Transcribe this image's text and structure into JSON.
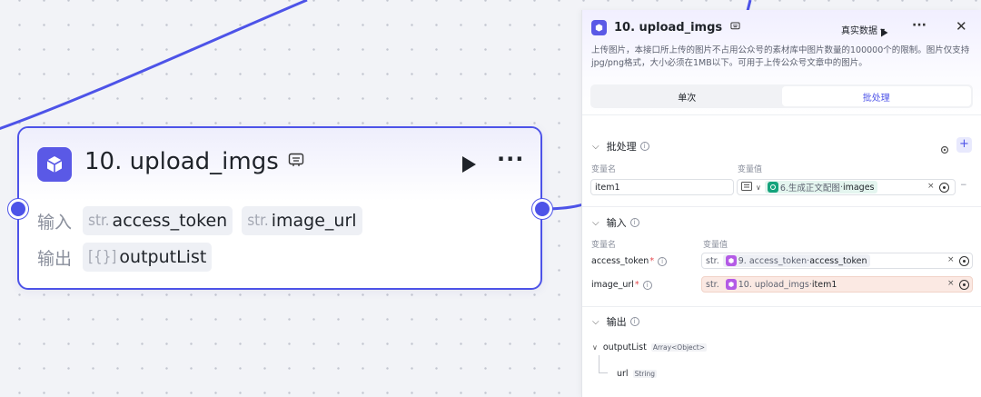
{
  "node": {
    "title": "10. upload_imgs",
    "input_label": "输入",
    "output_label": "输出",
    "inputs": [
      {
        "type": "str.",
        "name": "access_token"
      },
      {
        "type": "str.",
        "name": "image_url"
      }
    ],
    "outputs": [
      {
        "type": "[{}]",
        "name": "outputList"
      }
    ],
    "more": "···"
  },
  "panel": {
    "title": "10. upload_imgs",
    "mode": "真实数据 ▾",
    "more": "···",
    "close": "✕",
    "description": "上传图片，本接口所上传的图片不占用公众号的素材库中图片数量的100000个的限制。图片仅支持jpg/png格式，大小必须在1MB以下。可用于上传公众号文章中的图片。",
    "tabs": [
      {
        "label": "单次",
        "active": false
      },
      {
        "label": "批处理",
        "active": true
      }
    ],
    "batch": {
      "title": "批处理",
      "col_name": "变量名",
      "col_value": "变量值",
      "item_name": "item1",
      "ref_node": "6.生成正文配图",
      "ref_sep": " · ",
      "ref_field": "images",
      "x": "×",
      "dash": "−"
    },
    "input": {
      "title": "输入",
      "col_name": "变量名",
      "col_value": "变量值",
      "params": [
        {
          "name": "access_token",
          "type": "str.",
          "ref_node": "9. access_token",
          "ref_field": "access_token",
          "x": "×"
        },
        {
          "name": "image_url",
          "type": "str.",
          "ref_node": "10. upload_imgs",
          "ref_field": "item1",
          "x": "×"
        }
      ]
    },
    "output": {
      "title": "输出",
      "tree": [
        {
          "name": "outputList",
          "type": "Array<Object>"
        },
        {
          "name": "url",
          "type": "String"
        }
      ]
    }
  },
  "colors": {
    "accent": "#4d53e8",
    "node_icon": "#5a59e6",
    "batch_ref": "#15a37c",
    "param_highlight": "#fbe9e3"
  }
}
